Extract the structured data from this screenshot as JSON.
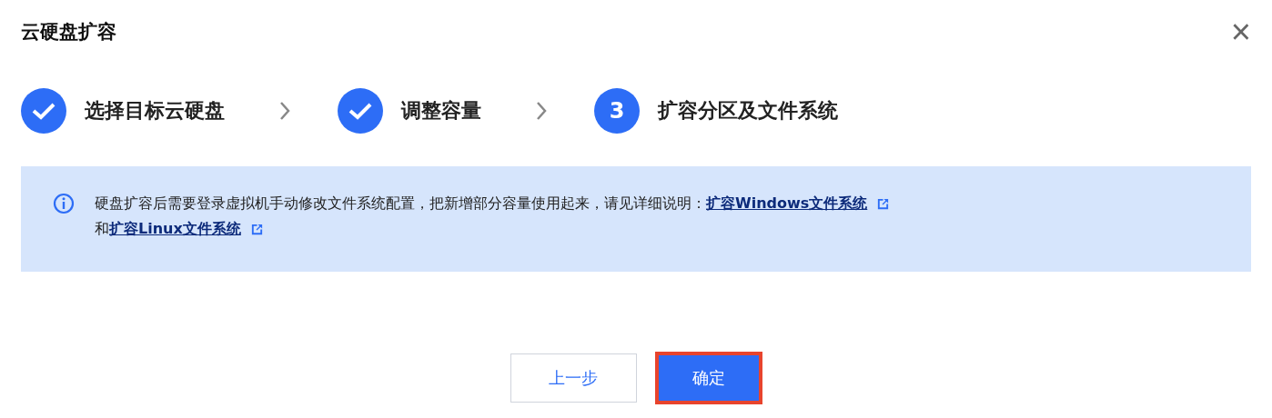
{
  "dialog": {
    "title": "云硬盘扩容",
    "close_label": "×"
  },
  "steps": [
    {
      "label": "选择目标云硬盘",
      "done": true
    },
    {
      "label": "调整容量",
      "done": true
    },
    {
      "label": "扩容分区及文件系统",
      "done": false,
      "number": "3"
    }
  ],
  "notice": {
    "lines": [
      [
        {
          "kind": "text",
          "text": "硬盘扩容后需要登录虚拟机手动修改文件系统配置，把新增部分容量使用起来，请见详细说明："
        },
        {
          "kind": "link",
          "text": "扩容Windows文件系统"
        }
      ],
      [
        {
          "kind": "text",
          "text": "和"
        },
        {
          "kind": "link",
          "text": "扩容Linux文件系统"
        }
      ]
    ]
  },
  "buttons": [
    {
      "label": "上一步",
      "kind": "secondary",
      "highlighted": false
    },
    {
      "label": "确定",
      "kind": "primary",
      "highlighted": true
    }
  ]
}
